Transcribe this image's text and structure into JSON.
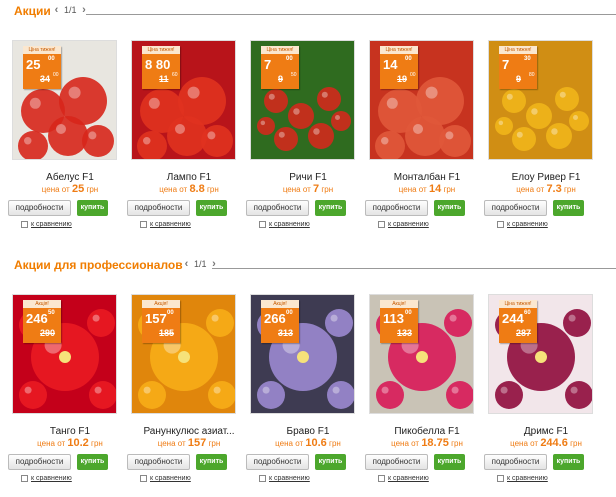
{
  "section1": {
    "title": "Акции",
    "pager": "1/1",
    "products": [
      {
        "name": "Абелус F1",
        "price_prefix": "цена от",
        "price": "25",
        "currency": "грн",
        "tag_label": "Ціна тижня!",
        "tag_new": "25",
        "tag_new_kop": "00",
        "tag_old": "34",
        "tag_old_kop": "00"
      },
      {
        "name": "Лампо F1",
        "price_prefix": "цена от",
        "price": "8.8",
        "currency": "грн",
        "tag_label": "Ціна тижня!",
        "tag_new": "8 80",
        "tag_new_kop": "",
        "tag_old": "11",
        "tag_old_kop": "60"
      },
      {
        "name": "Ричи F1",
        "price_prefix": "цена от",
        "price": "7",
        "currency": "грн",
        "tag_label": "Ціна тижня!",
        "tag_new": "7",
        "tag_new_kop": "00",
        "tag_old": "9",
        "tag_old_kop": "50"
      },
      {
        "name": "Монталбан F1",
        "price_prefix": "цена от",
        "price": "14",
        "currency": "грн",
        "tag_label": "Ціна тижня!",
        "tag_new": "14",
        "tag_new_kop": "00",
        "tag_old": "19",
        "tag_old_kop": "00"
      },
      {
        "name": "Елоу Ривер F1",
        "price_prefix": "цена от",
        "price": "7.3",
        "currency": "грн",
        "tag_label": "Ціна тижня!",
        "tag_new": "7",
        "tag_new_kop": "30",
        "tag_old": "9",
        "tag_old_kop": "80"
      }
    ]
  },
  "section2": {
    "title": "Акции для профессионалов",
    "pager": "1/1",
    "products": [
      {
        "name": "Танго F1",
        "price_prefix": "цена от",
        "price": "10.2",
        "currency": "грн",
        "tag_label": "Акція!",
        "tag_new": "246",
        "tag_new_kop": "50",
        "tag_old": "290",
        "tag_old_kop": ""
      },
      {
        "name": "Ранункулюс азиат...",
        "price_prefix": "цена от",
        "price": "157",
        "currency": "грн",
        "tag_label": "Акція!",
        "tag_new": "157",
        "tag_new_kop": "00",
        "tag_old": "185",
        "tag_old_kop": ""
      },
      {
        "name": "Браво F1",
        "price_prefix": "цена от",
        "price": "10.6",
        "currency": "грн",
        "tag_label": "Акція!",
        "tag_new": "266",
        "tag_new_kop": "00",
        "tag_old": "313",
        "tag_old_kop": ""
      },
      {
        "name": "Пикобелла F1",
        "price_prefix": "цена от",
        "price": "18.75",
        "currency": "грн",
        "tag_label": "Акція!",
        "tag_new": "113",
        "tag_new_kop": "00",
        "tag_old": "133",
        "tag_old_kop": ""
      },
      {
        "name": "Дримс F1",
        "price_prefix": "цена от",
        "price": "244.6",
        "currency": "грн",
        "tag_label": "Ціна тижня!",
        "tag_new": "244",
        "tag_new_kop": "60",
        "tag_old": "287",
        "tag_old_kop": ""
      }
    ]
  },
  "buttons": {
    "details": "подробности",
    "buy": "купить",
    "compare": "к сравнению"
  },
  "icons": {
    "prev": "chevron-left-icon",
    "next": "chevron-right-icon"
  },
  "colors": {
    "accent": "#f07d00",
    "buy": "#4ca72c",
    "tag": "#ef7c14"
  }
}
